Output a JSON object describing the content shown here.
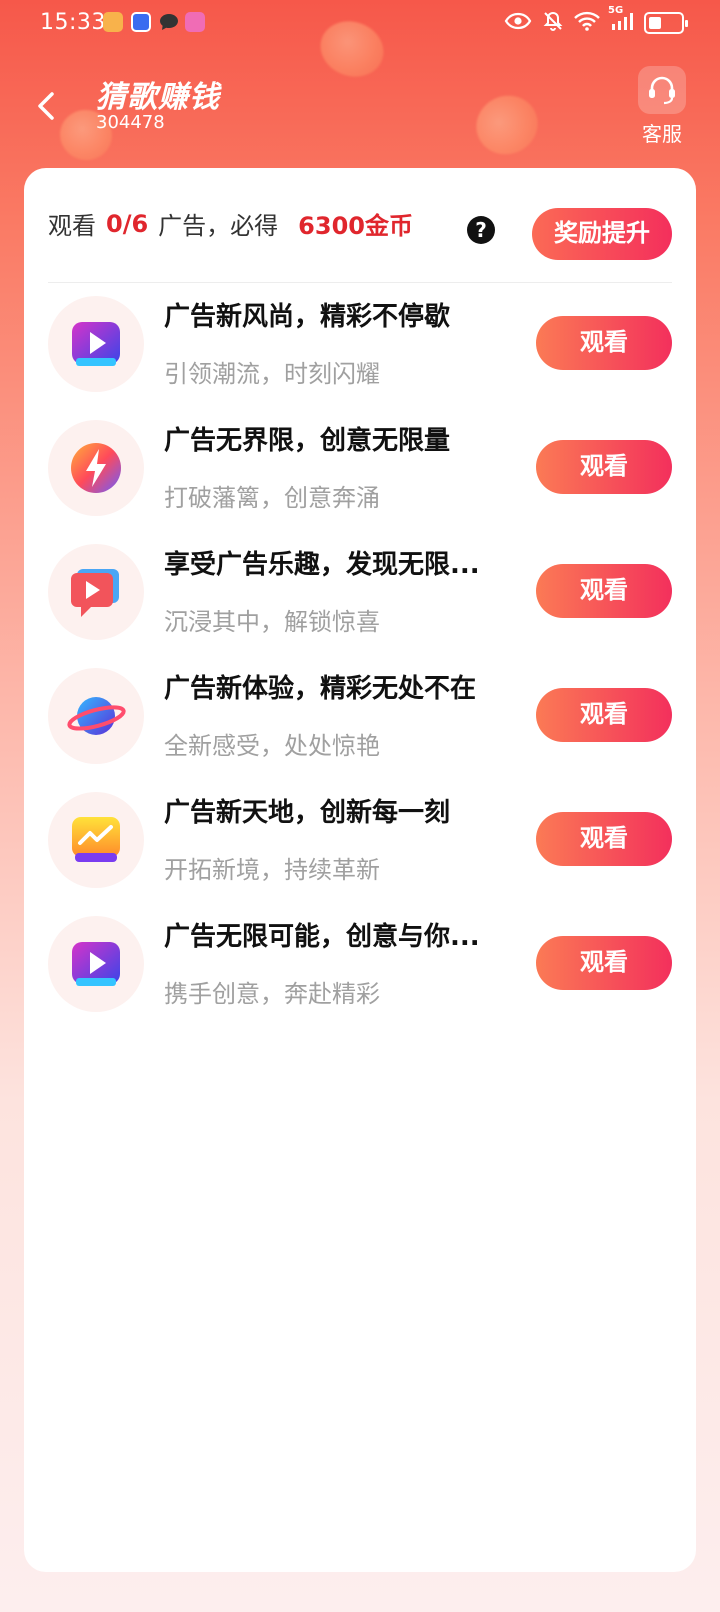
{
  "status_bar": {
    "time": "15:33",
    "network": "5G"
  },
  "header": {
    "title": "猜歌赚钱",
    "subtitle": "304478",
    "service_label": "客服"
  },
  "summary": {
    "prefix": "观看",
    "progress": "0/6",
    "middle": "广告，必得",
    "reward": "6300金币",
    "boost_label": "奖励提升"
  },
  "ads": [
    {
      "title": "广告新风尚，精彩不停歇",
      "subtitle": "引领潮流，时刻闪耀",
      "button": "观看",
      "icon": "video-play-icon"
    },
    {
      "title": "广告无界限，创意无限量",
      "subtitle": "打破藩篱，创意奔涌",
      "button": "观看",
      "icon": "lightning-icon"
    },
    {
      "title": "享受广告乐趣，发现无限...",
      "subtitle": "沉浸其中，解锁惊喜",
      "button": "观看",
      "icon": "video-bubble-icon"
    },
    {
      "title": "广告新体验，精彩无处不在",
      "subtitle": "全新感受，处处惊艳",
      "button": "观看",
      "icon": "planet-icon"
    },
    {
      "title": "广告新天地，创新每一刻",
      "subtitle": "开拓新境，持续革新",
      "button": "观看",
      "icon": "chart-trend-icon"
    },
    {
      "title": "广告无限可能，创意与你...",
      "subtitle": "携手创意，奔赴精彩",
      "button": "观看",
      "icon": "video-play-icon"
    }
  ],
  "colors": {
    "accent_red": "#e0262d",
    "button_gradient_start": "#fb7a55",
    "button_gradient_end": "#f3305c",
    "header_bg": "#f6584a"
  }
}
